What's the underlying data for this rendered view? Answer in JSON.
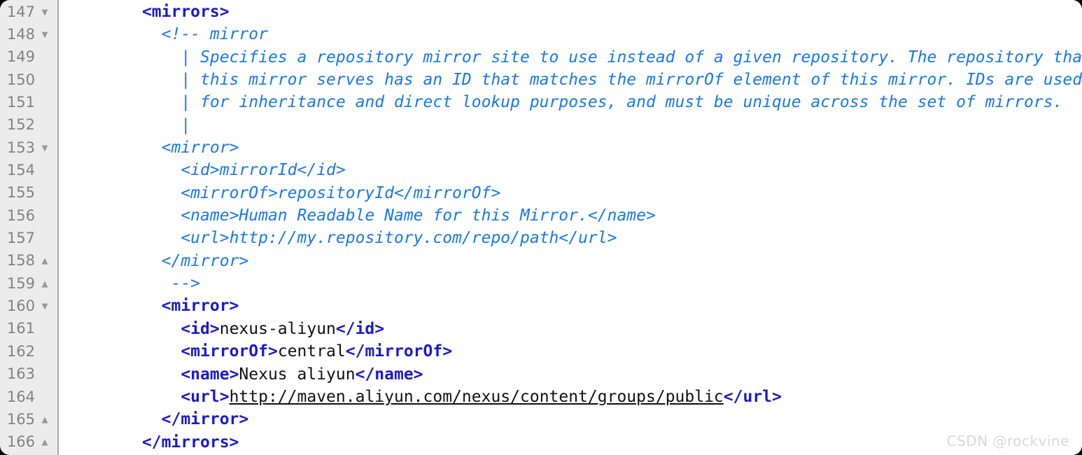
{
  "editor": {
    "language": "xml",
    "colors": {
      "background": "#ffffff",
      "gutter_background": "#ececec",
      "gutter_border": "#a8a8a8",
      "line_number": "#828282",
      "fold_arrow": "#9a9a9a",
      "comment_blue": "#1878ee",
      "tag_blue": "#1a1ad2",
      "text_black": "#111111",
      "outer_background": "#000000",
      "watermark": "#d8d8d8"
    },
    "icons": {
      "fold_collapse": "▼",
      "fold_expand": "▲"
    },
    "gutter": [
      {
        "number": "147",
        "fold": "▼"
      },
      {
        "number": "148",
        "fold": "▼"
      },
      {
        "number": "149",
        "fold": ""
      },
      {
        "number": "150",
        "fold": ""
      },
      {
        "number": "151",
        "fold": ""
      },
      {
        "number": "152",
        "fold": ""
      },
      {
        "number": "153",
        "fold": "▼"
      },
      {
        "number": "154",
        "fold": ""
      },
      {
        "number": "155",
        "fold": ""
      },
      {
        "number": "156",
        "fold": ""
      },
      {
        "number": "157",
        "fold": ""
      },
      {
        "number": "158",
        "fold": "▲"
      },
      {
        "number": "159",
        "fold": "▲"
      },
      {
        "number": "160",
        "fold": "▼"
      },
      {
        "number": "161",
        "fold": ""
      },
      {
        "number": "162",
        "fold": ""
      },
      {
        "number": "163",
        "fold": ""
      },
      {
        "number": "164",
        "fold": ""
      },
      {
        "number": "165",
        "fold": "▲"
      },
      {
        "number": "166",
        "fold": "▲"
      }
    ],
    "lines": [
      {
        "n": "147",
        "indent": 7,
        "parts": [
          {
            "t": "tag",
            "v": "<mirrors>"
          }
        ]
      },
      {
        "n": "148",
        "indent": 9,
        "parts": [
          {
            "t": "cmt",
            "v": "<!-- mirror"
          }
        ]
      },
      {
        "n": "149",
        "indent": 11,
        "parts": [
          {
            "t": "cmt",
            "v": "| Specifies a repository mirror site to use instead of a given repository. The repository that"
          }
        ]
      },
      {
        "n": "150",
        "indent": 11,
        "parts": [
          {
            "t": "cmt",
            "v": "| this mirror serves has an ID that matches the mirrorOf element of this mirror. IDs are used"
          }
        ]
      },
      {
        "n": "151",
        "indent": 11,
        "parts": [
          {
            "t": "cmt",
            "v": "| for inheritance and direct lookup purposes, and must be unique across the set of mirrors."
          }
        ]
      },
      {
        "n": "152",
        "indent": 11,
        "parts": [
          {
            "t": "cmt",
            "v": "|"
          }
        ]
      },
      {
        "n": "153",
        "indent": 9,
        "parts": [
          {
            "t": "cmt",
            "v": "<mirror>"
          }
        ]
      },
      {
        "n": "154",
        "indent": 11,
        "parts": [
          {
            "t": "cmt",
            "v": "<id>mirrorId</id>"
          }
        ]
      },
      {
        "n": "155",
        "indent": 11,
        "parts": [
          {
            "t": "cmt",
            "v": "<mirrorOf>repositoryId</mirrorOf>"
          }
        ]
      },
      {
        "n": "156",
        "indent": 11,
        "parts": [
          {
            "t": "cmt",
            "v": "<name>Human Readable Name for this Mirror.</name>"
          }
        ]
      },
      {
        "n": "157",
        "indent": 11,
        "parts": [
          {
            "t": "cmt",
            "v": "<url>"
          },
          {
            "t": "cmt-u",
            "v": "http://my.repository.com/repo/path"
          },
          {
            "t": "cmt",
            "v": "</url>"
          }
        ]
      },
      {
        "n": "158",
        "indent": 9,
        "parts": [
          {
            "t": "cmt",
            "v": "</mirror>"
          }
        ]
      },
      {
        "n": "159",
        "indent": 10,
        "parts": [
          {
            "t": "cmt",
            "v": "-->"
          }
        ]
      },
      {
        "n": "160",
        "indent": 9,
        "parts": [
          {
            "t": "tag",
            "v": "<mirror>"
          }
        ]
      },
      {
        "n": "161",
        "indent": 11,
        "parts": [
          {
            "t": "tag",
            "v": "<id>"
          },
          {
            "t": "txt",
            "v": "nexus-aliyun"
          },
          {
            "t": "tag",
            "v": "</id>"
          }
        ]
      },
      {
        "n": "162",
        "indent": 11,
        "parts": [
          {
            "t": "tag",
            "v": "<mirrorOf>"
          },
          {
            "t": "txt",
            "v": "central"
          },
          {
            "t": "tag",
            "v": "</mirrorOf>"
          }
        ]
      },
      {
        "n": "163",
        "indent": 11,
        "parts": [
          {
            "t": "tag",
            "v": "<name>"
          },
          {
            "t": "txt",
            "v": "Nexus aliyun"
          },
          {
            "t": "tag",
            "v": "</name>"
          }
        ]
      },
      {
        "n": "164",
        "indent": 11,
        "parts": [
          {
            "t": "tag",
            "v": "<url>"
          },
          {
            "t": "txt-u",
            "v": "http://maven.aliyun.com/nexus/content/groups/public"
          },
          {
            "t": "tag",
            "v": "</url>"
          }
        ]
      },
      {
        "n": "165",
        "indent": 9,
        "parts": [
          {
            "t": "tag",
            "v": "</mirror>"
          }
        ]
      },
      {
        "n": "166",
        "indent": 7,
        "parts": [
          {
            "t": "tag",
            "v": "</mirrors>"
          }
        ]
      }
    ]
  },
  "watermark": {
    "text": "CSDN @rockvine"
  }
}
